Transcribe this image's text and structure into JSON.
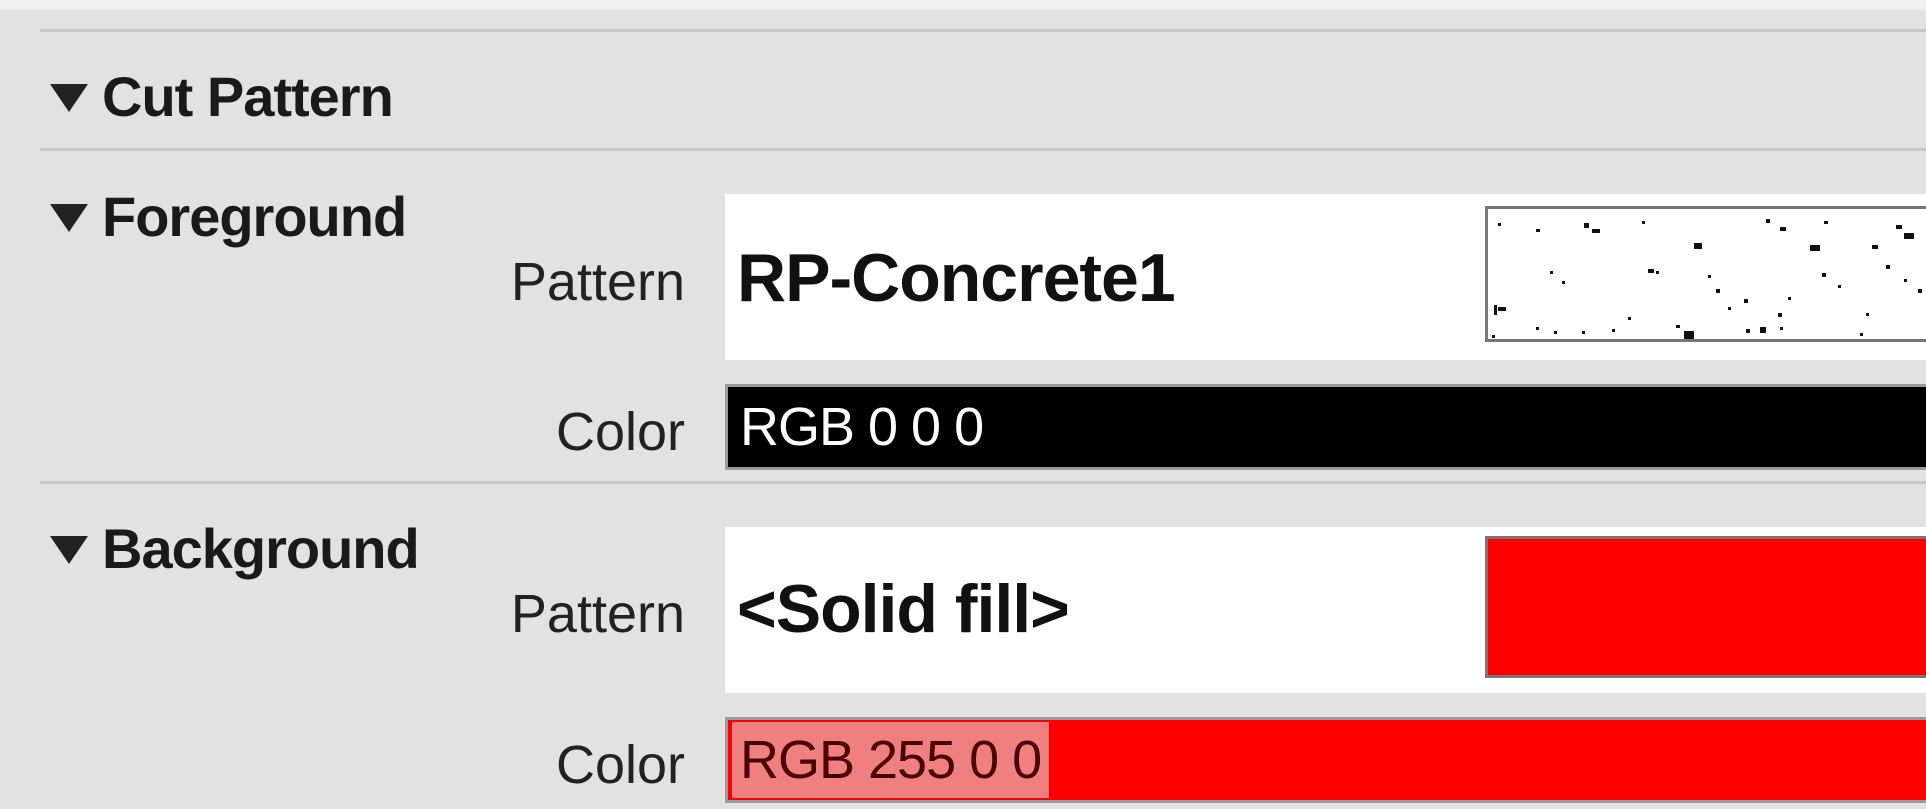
{
  "sections": {
    "cut_pattern": {
      "label": "Cut Pattern",
      "icon": "triangle-down-icon"
    },
    "foreground": {
      "label": "Foreground",
      "icon": "triangle-down-icon",
      "pattern_label": "Pattern",
      "pattern_value": "RP-Concrete1",
      "color_label": "Color",
      "color_value": "RGB 0 0 0",
      "color_hex": "#000000"
    },
    "background": {
      "label": "Background",
      "icon": "triangle-down-icon",
      "pattern_label": "Pattern",
      "pattern_value": "<Solid fill>",
      "color_label": "Color",
      "color_value": "RGB 255 0 0",
      "color_hex": "#ff0000"
    }
  }
}
